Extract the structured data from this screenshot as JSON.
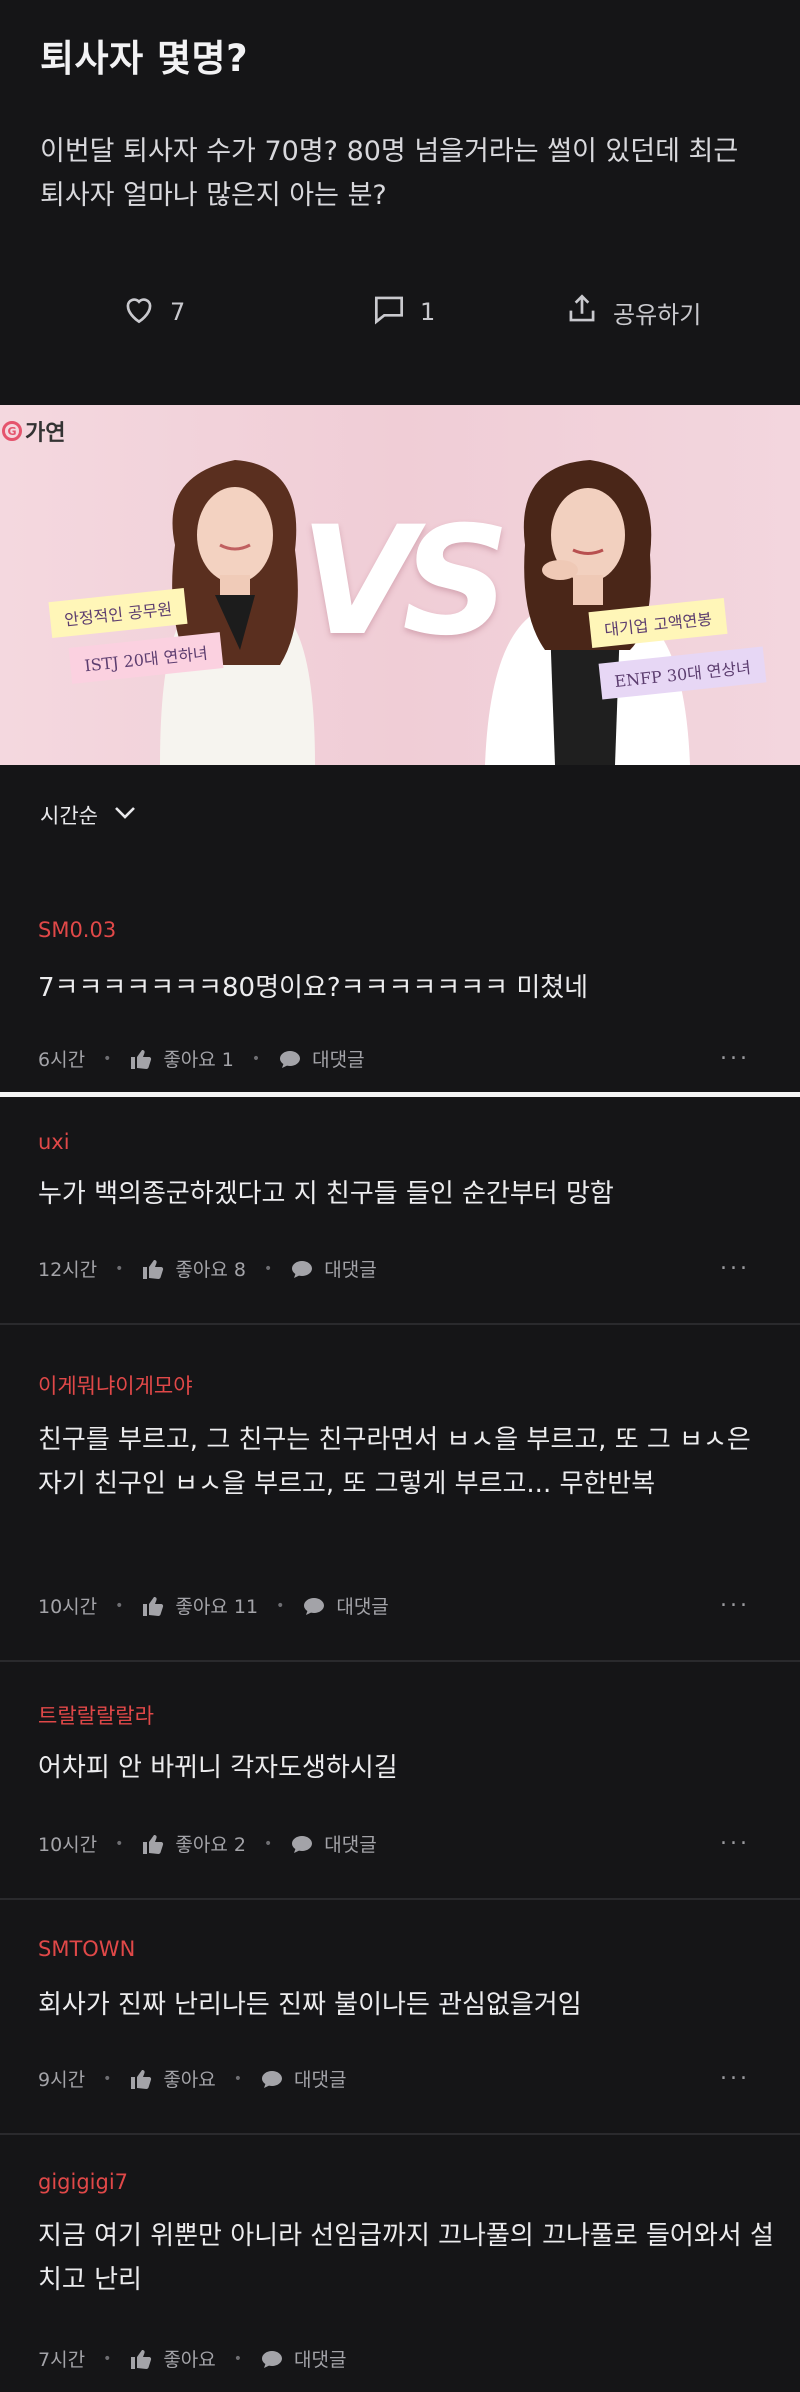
{
  "post": {
    "title": "퇴사자 몇명?",
    "body": "이번달 퇴사자 수가 70명? 80명 넘을거라는 썰이 있던데 최근 퇴사자 얼마나 많은지 아는 분?",
    "likes": "7",
    "comments": "1",
    "share_label": "공유하기"
  },
  "banner": {
    "brand": "가연",
    "vs": "VS",
    "left_note_1": "안정적인 공무원",
    "left_note_2": "ISTJ 20대 연하녀",
    "right_note_1": "대기업 고액연봉",
    "right_note_2": "ENFP 30대 연상녀"
  },
  "sort": {
    "label": "시간순"
  },
  "comments": [
    {
      "author": "SM0.03",
      "text": "7ㅋㅋㅋㅋㅋㅋㅋ80명이요?ㅋㅋㅋㅋㅋㅋㅋ 미쳤네",
      "time": "6시간",
      "like": "좋아요 1",
      "reply": "대댓글"
    },
    {
      "author": "uxi",
      "text": "누가 백의종군하겠다고 지 친구들 들인 순간부터 망함",
      "time": "12시간",
      "like": "좋아요 8",
      "reply": "대댓글"
    },
    {
      "author": "이게뭐냐이게모야",
      "text": "친구를 부르고, 그 친구는 친구라면서 ㅂㅅ을 부르고, 또 그 ㅂㅅ은 자기 친구인 ㅂㅅ을 부르고, 또 그렇게 부르고... 무한반복",
      "time": "10시간",
      "like": "좋아요 11",
      "reply": "대댓글"
    },
    {
      "author": "트랄랄랄랄라",
      "text": "어차피 안 바뀌니 각자도생하시길",
      "time": "10시간",
      "like": "좋아요 2",
      "reply": "대댓글"
    },
    {
      "author": "SMTOWN",
      "text": "회사가 진짜 난리나든 진짜 불이나든 관심없을거임",
      "time": "9시간",
      "like": "좋아요",
      "reply": "대댓글"
    },
    {
      "author": "gigigigi7",
      "text": "지금 여기 위뿐만 아니라 선임급까지 끄나풀의 끄나풀로 들어와서 설치고 난리",
      "time": "7시간",
      "like": "좋아요",
      "reply": "대댓글"
    }
  ],
  "more_label": "...",
  "colors": {
    "background": "#151517",
    "author": "#e04848",
    "banner": "#f0cdd6"
  }
}
